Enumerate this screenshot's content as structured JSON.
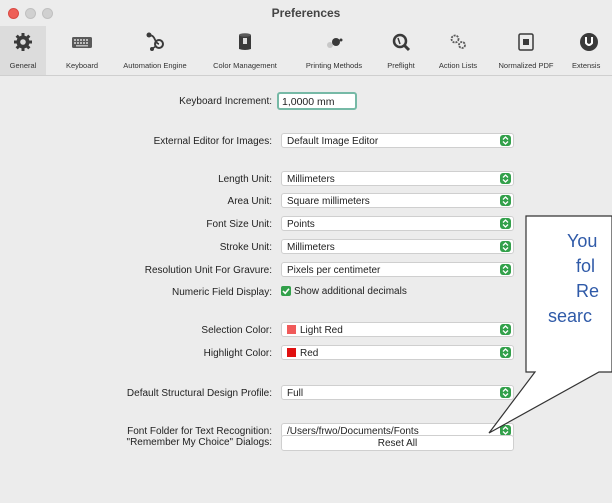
{
  "window": {
    "title": "Preferences"
  },
  "toolbar": {
    "items": [
      {
        "label": "General",
        "icon": "gear-icon",
        "selected": true
      },
      {
        "label": "Keyboard",
        "icon": "keyboard-icon"
      },
      {
        "label": "Automation Engine",
        "icon": "automation-engine-icon"
      },
      {
        "label": "Color Management",
        "icon": "color-management-icon"
      },
      {
        "label": "Printing Methods",
        "icon": "printing-methods-icon"
      },
      {
        "label": "Preflight",
        "icon": "preflight-icon"
      },
      {
        "label": "Action Lists",
        "icon": "action-lists-icon"
      },
      {
        "label": "Normalized PDF",
        "icon": "normalized-pdf-icon"
      },
      {
        "label": "Extensis",
        "icon": "extensis-icon"
      }
    ]
  },
  "form": {
    "keyboard_increment": {
      "label": "Keyboard Increment:",
      "value": "1,0000 mm"
    },
    "external_editor": {
      "label": "External Editor for Images:",
      "value": "Default Image Editor"
    },
    "length_unit": {
      "label": "Length Unit:",
      "value": "Millimeters"
    },
    "area_unit": {
      "label": "Area Unit:",
      "value": "Square millimeters"
    },
    "font_size_unit": {
      "label": "Font Size Unit:",
      "value": "Points"
    },
    "stroke_unit": {
      "label": "Stroke Unit:",
      "value": "Millimeters"
    },
    "resolution_unit": {
      "label": "Resolution Unit For Gravure:",
      "value": "Pixels per centimeter"
    },
    "numeric_display": {
      "label": "Numeric Field Display:",
      "checkbox_label": "Show additional decimals",
      "checked": true
    },
    "selection_color": {
      "label": "Selection Color:",
      "value": "Light Red",
      "swatch": "#f05a5a"
    },
    "highlight_color": {
      "label": "Highlight Color:",
      "value": "Red",
      "swatch": "#e01010"
    },
    "structural_profile": {
      "label": "Default Structural Design Profile:",
      "value": "Full"
    },
    "font_folder": {
      "label": "Font Folder for Text Recognition:",
      "value": "/Users/frwo/Documents/Fonts"
    },
    "remember_choice": {
      "label": "\"Remember My Choice\" Dialogs:",
      "button": "Reset All"
    }
  },
  "callout": {
    "line1": "You",
    "line2": "fol",
    "line3": "Re",
    "line4": "searc"
  },
  "colors": {
    "accent": "#32a04a",
    "callout_text": "#2f5aa8"
  }
}
